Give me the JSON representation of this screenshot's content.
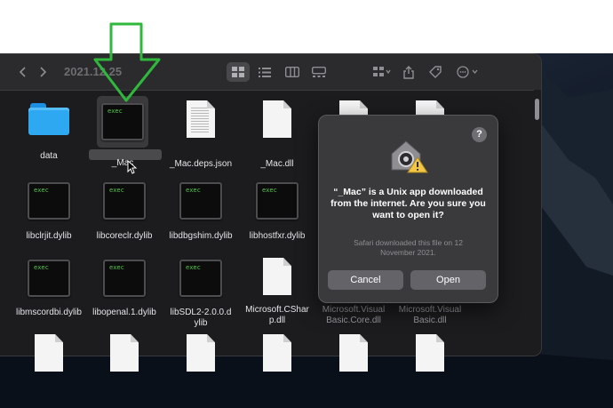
{
  "window": {
    "path_title": "2021.12.25"
  },
  "toolbar": {
    "back_icon": "chevron-left-icon",
    "forward_icon": "chevron-right-icon",
    "view_modes": [
      "icon-view",
      "list-view",
      "column-view",
      "gallery-view"
    ],
    "actions": [
      "group-icon",
      "share-icon",
      "tag-icon",
      "more-icon"
    ]
  },
  "files": [
    {
      "label": "data",
      "kind": "folder"
    },
    {
      "label": "_Mac",
      "kind": "exec",
      "selected": true
    },
    {
      "label": "_Mac.deps.json",
      "kind": "doc-text"
    },
    {
      "label": "_Mac.dll",
      "kind": "doc"
    },
    {
      "label": "",
      "kind": "doc"
    },
    {
      "label": "",
      "kind": "doc"
    },
    {
      "label": "libclrjit.dylib",
      "kind": "exec"
    },
    {
      "label": "libcoreclr.dylib",
      "kind": "exec"
    },
    {
      "label": "libdbgshim.dylib",
      "kind": "exec"
    },
    {
      "label": "libhostfxr.dylib",
      "kind": "exec"
    },
    {
      "label": "libmscordbi.dylib",
      "kind": "exec"
    },
    {
      "label": "libopenal.1.dylib",
      "kind": "exec"
    },
    {
      "label": "libSDL2-2.0.0.dylib",
      "kind": "exec"
    },
    {
      "label": "Microsoft.CSharp.dll",
      "kind": "doc"
    },
    {
      "label": "Microsoft.VisualBasic.Core.dll",
      "kind": "doc"
    },
    {
      "label": "Microsoft.VisualBasic.dll",
      "kind": "doc"
    }
  ],
  "exec_badge": "exec",
  "dialog": {
    "message": "“_Mac” is a Unix app downloaded from the internet. Are you sure you want to open it?",
    "subtext": "Safari downloaded this file on 12 November 2021.",
    "cancel_label": "Cancel",
    "open_label": "Open",
    "help_label": "?"
  },
  "colors": {
    "arrow_green": "#2fb83c",
    "folder_blue": "#2fa8f2",
    "window_bg": "#1c1c1e"
  }
}
